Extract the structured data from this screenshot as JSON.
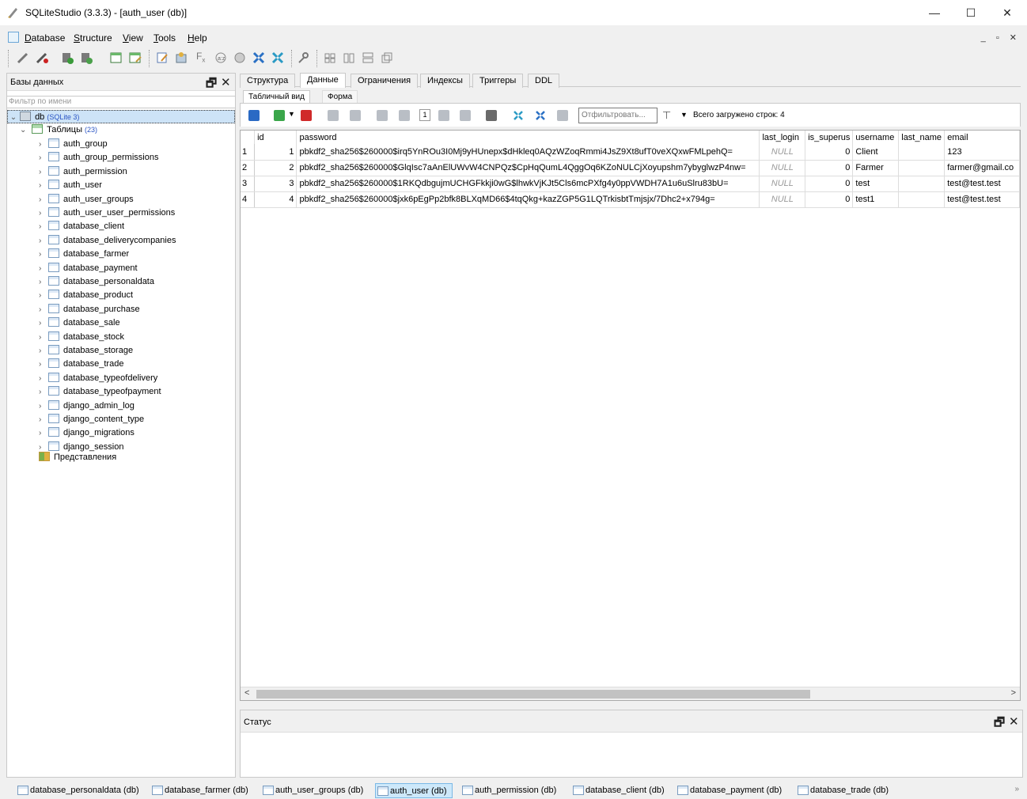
{
  "window": {
    "title": "SQLiteStudio (3.3.3) - [auth_user (db)]"
  },
  "menu": [
    "Database",
    "Structure",
    "View",
    "Tools",
    "Help"
  ],
  "menu_underline": [
    "D",
    "S",
    "V",
    "T",
    "H"
  ],
  "menu_rest": [
    "atabase",
    "tructure",
    "iew",
    "ools",
    "elp"
  ],
  "left_panel": {
    "title": "Базы данных",
    "filter_placeholder": "Фильтр по имени",
    "db_name": "db",
    "db_type": "(SQLite 3)",
    "tables_label": "Таблицы",
    "tables_count": "(23)",
    "tables": [
      "auth_group",
      "auth_group_permissions",
      "auth_permission",
      "auth_user",
      "auth_user_groups",
      "auth_user_user_permissions",
      "database_client",
      "database_deliverycompanies",
      "database_farmer",
      "database_payment",
      "database_personaldata",
      "database_product",
      "database_purchase",
      "database_sale",
      "database_stock",
      "database_storage",
      "database_trade",
      "database_typeofdelivery",
      "database_typeofpayment",
      "django_admin_log",
      "django_content_type",
      "django_migrations",
      "django_session"
    ],
    "views_label": "Представления"
  },
  "tabs": [
    "Структура",
    "Данные",
    "Ограничения",
    "Индексы",
    "Триггеры",
    "DDL"
  ],
  "subtabs": [
    "Табличный вид",
    "Форма"
  ],
  "data_toolbar": {
    "page": "1",
    "filter_placeholder": "Отфильтровать...",
    "row_count": "Всего загружено строк: 4"
  },
  "grid": {
    "columns": [
      "id",
      "password",
      "last_login",
      "is_superus",
      "username",
      "last_name",
      "email"
    ],
    "rows": [
      {
        "rownum": "1",
        "id": "1",
        "password": "pbkdf2_sha256$260000$irq5YnROu3I0Mj9yHUnepx$dHkleq0AQzWZoqRmmi4JsZ9Xt8ufT0veXQxwFMLpehQ=",
        "last_login": "NULL",
        "is_superuser": "0",
        "username": "Client",
        "last_name": "",
        "email": "123"
      },
      {
        "rownum": "2",
        "id": "2",
        "password": "pbkdf2_sha256$260000$GlqIsc7aAnElUWvW4CNPQz$CpHqQumL4QggOq6KZoNULCjXoyupshm7ybyglwzP4nw=",
        "last_login": "NULL",
        "is_superuser": "0",
        "username": "Farmer",
        "last_name": "",
        "email": "farmer@gmail.co"
      },
      {
        "rownum": "3",
        "id": "3",
        "password": "pbkdf2_sha256$260000$1RKQdbgujmUCHGFkkji0wG$lhwkVjKJt5Cls6mcPXfg4y0ppVWDH7A1u6uSlru83bU=",
        "last_login": "NULL",
        "is_superuser": "0",
        "username": "test",
        "last_name": "",
        "email": "test@test.test"
      },
      {
        "rownum": "4",
        "id": "4",
        "password": "pbkdf2_sha256$260000$jxk6pEgPp2bfk8BLXqMD66$4tqQkg+kazZGP5G1LQTrkisbtTmjsjx/7Dhc2+x794g=",
        "last_login": "NULL",
        "is_superuser": "0",
        "username": "test1",
        "last_name": "",
        "email": "test@test.test"
      }
    ]
  },
  "status_panel": {
    "title": "Статус"
  },
  "taskbar": [
    "database_personaldata (db)",
    "database_farmer (db)",
    "auth_user_groups (db)",
    "auth_user (db)",
    "auth_permission (db)",
    "database_client (db)",
    "database_payment (db)",
    "database_trade (db)"
  ],
  "icons": [
    "connect-icon",
    "disconnect-icon",
    "add-db-icon",
    "remove-db-icon",
    "add-table-icon",
    "edit-table-icon",
    "sql-editor-icon",
    "function-icon",
    "collation-icon",
    "extension-icon",
    "import-icon",
    "export-icon",
    "settings-icon",
    "tile-icon",
    "cascade-icon"
  ],
  "colors": {
    "selection": "#cde3f7",
    "accent_blue": "#2a54c4",
    "null_text": "#9a9a9a"
  }
}
